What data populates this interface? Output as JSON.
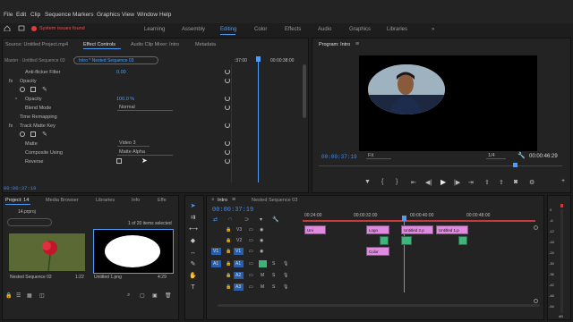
{
  "menu": [
    "File",
    "Edit",
    "Clip",
    "Sequence",
    "Markers",
    "Graphics",
    "View",
    "Window",
    "Help"
  ],
  "workspaces": [
    "Learning",
    "Assembly",
    "Editing",
    "Color",
    "Effects",
    "Audio",
    "Graphics",
    "Libraries"
  ],
  "workspace_active": "Editing",
  "workspace_more": "»",
  "system_issue": "System issues found",
  "source_panel": {
    "tab_source": "Source: Untitled Project.mp4",
    "tab_effect_controls": "Effect Controls",
    "tab_audio_mixer": "Audio Clip Mixer: Intro",
    "tab_metadata": "Metadata",
    "master": "Master · Untitled Sequence 03",
    "clip": "Intro * Nested Sequence 03",
    "time_start": ":37:00",
    "time_end": "00:00:38:00",
    "rows": {
      "anti_flicker": "Anti-flicker Filter",
      "anti_flicker_val": "0.00",
      "opacity_group": "Opacity",
      "opacity": "Opacity",
      "opacity_val": "100.0 %",
      "blend_mode": "Blend Mode",
      "blend_val": "Normal",
      "time_remap": "Time Remapping",
      "track_matte": "Track Matte Key",
      "matte": "Matte",
      "matte_val": "Video 3",
      "composite": "Composite Using",
      "composite_val": "Matte Alpha",
      "reverse": "Reverse"
    },
    "timecode": "00:00:37:19"
  },
  "program": {
    "title": "Program: Intro",
    "timecode": "00:00:37:19",
    "fit": "Fit",
    "fraction": "1/4",
    "duration": "00:00:46:29"
  },
  "project": {
    "tab_project": "Project: 14",
    "tab_media": "Media Browser",
    "tab_libraries": "Libraries",
    "tab_info": "Info",
    "tab_effects": "Effe",
    "file": "14.prproj",
    "selection": "1 of 20 items selected",
    "items": [
      {
        "name": "Nested Sequence 02",
        "duration": "1:22"
      },
      {
        "name": "Untitled 1.png",
        "duration": "4:29"
      }
    ]
  },
  "timeline": {
    "tab_intro": "Intro",
    "tab_nested": "Nested Sequence 03",
    "timecode": "00:00:37:19",
    "ruler": [
      "00:24:00",
      "00:00:32:00",
      "00:00:40:00",
      "00:00:48:00"
    ],
    "tracks_video": [
      "V3",
      "V2",
      "V1"
    ],
    "tracks_audio": [
      "A1",
      "A2",
      "A3"
    ],
    "source_v": "V1",
    "source_a": "A1",
    "clips": {
      "uni": "Uni",
      "logo": "Logo",
      "untitled2": "Untitled 2.p",
      "untitled1": "Untitled 1.p",
      "color": "Color"
    }
  },
  "meter_labels": [
    "0",
    "-6",
    "-12",
    "-18",
    "-24",
    "-30",
    "-36",
    "-42",
    "-48",
    "-54",
    "dB"
  ],
  "colors": {
    "accent": "#3f8cf0",
    "clip_pink": "#e08be0",
    "clip_green": "#3fb37a",
    "warning": "#e23b3b"
  }
}
